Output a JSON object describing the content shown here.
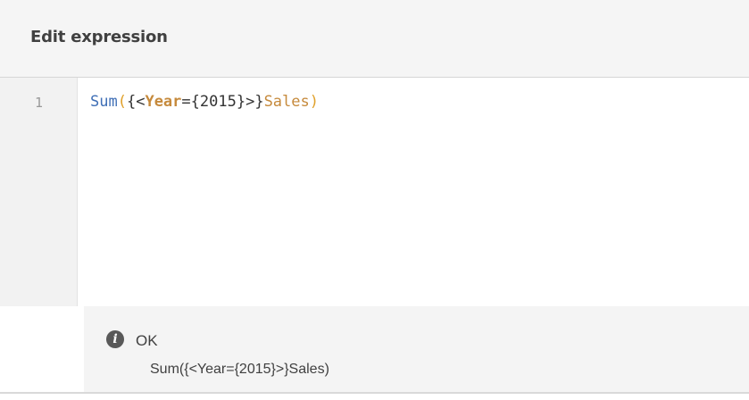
{
  "header": {
    "title": "Edit expression"
  },
  "editor": {
    "line_number": "1",
    "tokens": {
      "func": "Sum",
      "open_paren": "(",
      "open_set": "{<",
      "field": "Year",
      "assign": "=",
      "value": "{2015}",
      "close_set": ">}",
      "measure": "Sales",
      "close_paren": ")"
    }
  },
  "status": {
    "icon": "info-icon",
    "text": "OK",
    "result": "Sum({<Year={2015}>}Sales)"
  },
  "colors": {
    "function": "#3f6fb6",
    "paren": "#e0a12b",
    "field": "#c68a3c",
    "header_bg": "#f5f5f5",
    "panel_bg": "#f4f4f4"
  }
}
